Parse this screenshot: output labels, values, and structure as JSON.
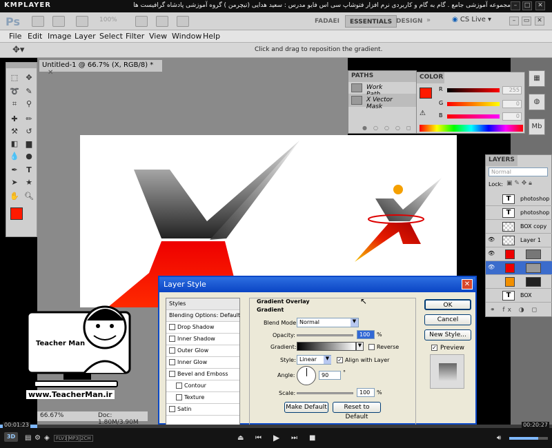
{
  "player": {
    "logo": "KMPLAYER",
    "title": "مجموعه آموزشی جامع . گام به گام و کاربردی نرم افزار فتوشاپ سی اس فایو  مدرس : سعید هدایی (تیچرمن ) گروه آموزشی پادشاه گرافیست ها",
    "time_current": "00:01:23",
    "time_total": "00:20:27",
    "badges": [
      "FLV1",
      "MP3",
      "2CH"
    ],
    "progress_fraction": 0.068
  },
  "ps": {
    "logo": "Ps",
    "zoom_select": "100%",
    "workspaces": [
      "FADAEI",
      "ESSENTIALS",
      "DESIGN"
    ],
    "cslive": "CS Live",
    "menu": [
      "File",
      "Edit",
      "Image",
      "Layer",
      "Select",
      "Filter",
      "View",
      "Window",
      "Help"
    ],
    "option_hint": "Click and drag to reposition the gradient.",
    "doc_tab": "Untitled-1 @ 66.7% (X, RGB/8) *",
    "status_zoom": "66.67%",
    "status_doc": "Doc: 1.80M/3.90M"
  },
  "paths": {
    "tab": "PATHS",
    "items": [
      "Work Path",
      "X Vector Mask"
    ]
  },
  "color": {
    "tab": "COLOR",
    "channels": [
      {
        "name": "R",
        "value": "255"
      },
      {
        "name": "G",
        "value": "0"
      },
      {
        "name": "B",
        "value": "0"
      }
    ],
    "foreground": "#ff1a00"
  },
  "layers": {
    "tab": "LAYERS",
    "blend": "Normal",
    "lock_label": "Lock:",
    "items": [
      "photoshop",
      "photoshop",
      "BOX copy",
      "Layer 1",
      "",
      "",
      "",
      "BOX"
    ]
  },
  "dialog": {
    "title": "Layer Style",
    "styles_header": "Styles",
    "blending_options": "Blending Options: Default",
    "effects": [
      "Drop Shadow",
      "Inner Shadow",
      "Outer Glow",
      "Inner Glow",
      "Bevel and Emboss",
      "Contour",
      "Texture",
      "Satin"
    ],
    "section": "Gradient Overlay",
    "subsection": "Gradient",
    "blend_mode_label": "Blend Mode:",
    "blend_mode": "Normal",
    "opacity_label": "Opacity:",
    "opacity": "100",
    "percent": "%",
    "gradient_label": "Gradient:",
    "reverse_label": "Reverse",
    "style_label": "Style:",
    "style": "Linear",
    "align_label": "Align with Layer",
    "angle_label": "Angle:",
    "angle": "90",
    "degree": "°",
    "scale_label": "Scale:",
    "scale": "100",
    "make_default": "Make Default",
    "reset_default": "Reset to Default",
    "ok": "OK",
    "cancel": "Cancel",
    "new_style": "New Style...",
    "preview": "Preview"
  },
  "watermark": {
    "brand": "Teacher Man",
    "url": "www.TeacherMan.ir"
  }
}
